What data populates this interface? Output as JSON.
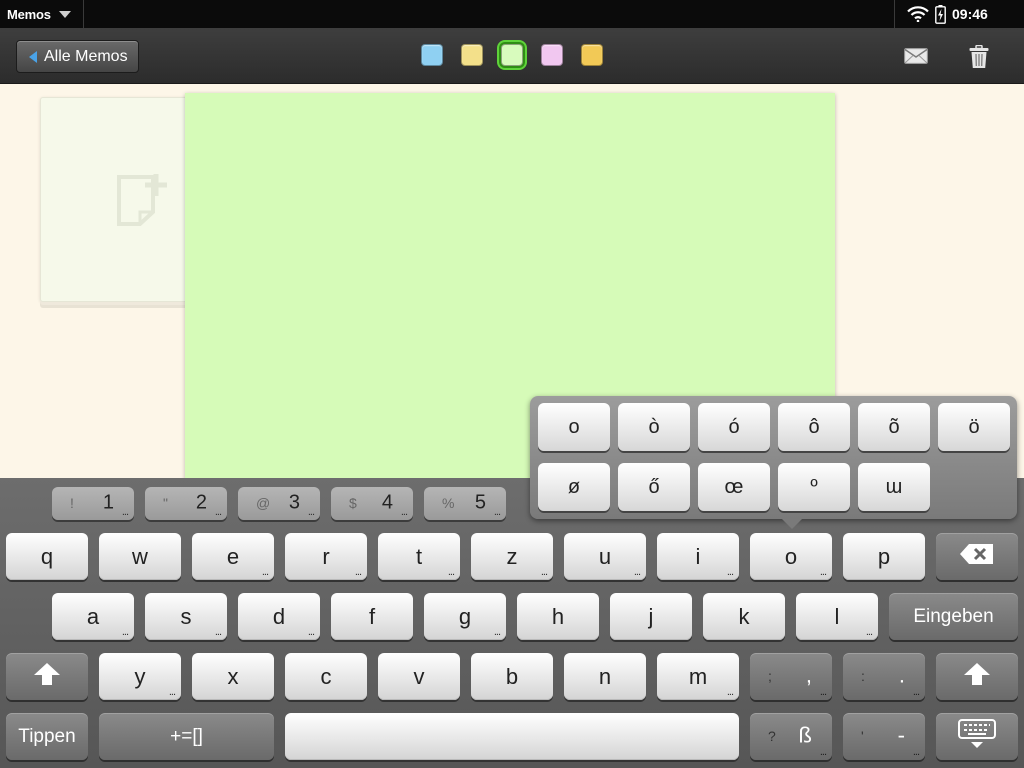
{
  "status_bar": {
    "app_name": "Memos",
    "time": "09:46"
  },
  "toolbar": {
    "back_label": "Alle Memos",
    "colors": [
      {
        "name": "blue",
        "hex": "#8fd0f2"
      },
      {
        "name": "yellow",
        "hex": "#f3e08a"
      },
      {
        "name": "green",
        "hex": "#d8fbbd",
        "selected": true
      },
      {
        "name": "pink",
        "hex": "#f1c7f0"
      },
      {
        "name": "orange",
        "hex": "#f2c956"
      }
    ]
  },
  "memo": {
    "color": "#d6fbb8",
    "text": ""
  },
  "accent_popup": {
    "row1": [
      "o",
      "ò",
      "ó",
      "ô",
      "õ",
      "ö"
    ],
    "row2": [
      "ø",
      "ő",
      "œ",
      "º",
      "ɯ"
    ]
  },
  "keyboard": {
    "number_row": [
      {
        "sec": "!",
        "pri": "1"
      },
      {
        "sec": "\"",
        "pri": "2"
      },
      {
        "sec": "@",
        "pri": "3"
      },
      {
        "sec": "$",
        "pri": "4"
      },
      {
        "sec": "%",
        "pri": "5"
      }
    ],
    "row_q": [
      "q",
      "w",
      "e",
      "r",
      "t",
      "z",
      "u",
      "i",
      "o",
      "p"
    ],
    "row_a": [
      "a",
      "s",
      "d",
      "f",
      "g",
      "h",
      "j",
      "k",
      "l"
    ],
    "row_y": [
      "y",
      "x",
      "c",
      "v",
      "b",
      "n",
      "m"
    ],
    "enter_label": "Eingeben",
    "semicolon_key": {
      "sec": ";",
      "pri": ","
    },
    "colon_key": {
      "sec": ":",
      "pri": "."
    },
    "question_key": {
      "sec": "?",
      "pri": "ß"
    },
    "apostrophe_key": {
      "sec": "'",
      "pri": "-"
    },
    "tippen_label": "Tippen",
    "symbols_label": "+=[]",
    "more_dots": "..."
  }
}
